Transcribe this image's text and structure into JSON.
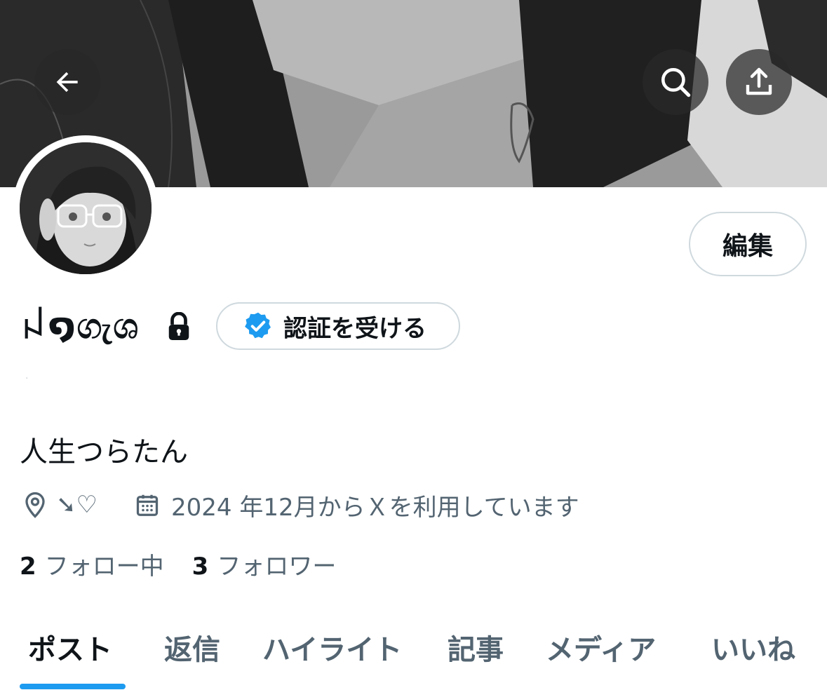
{
  "header": {
    "back_icon": "arrow-left-icon",
    "search_icon": "search-icon",
    "share_icon": "share-upload-icon"
  },
  "profile": {
    "display_name": "ꈤ໑ගැශ",
    "protected_icon": "lock-icon",
    "verify_label": "認証を受ける",
    "verify_icon": "verified-badge-icon",
    "edit_label": "編集",
    "handle": "·",
    "bio": "人生つらたん",
    "location": "➘♡",
    "location_icon": "location-pin-icon",
    "joined": "2024 年12月からＸを利用しています",
    "joined_icon": "calendar-icon",
    "following_count": "2",
    "following_label": "フォロー中",
    "followers_count": "3",
    "followers_label": "フォロワー"
  },
  "tabs": [
    {
      "label": "ポスト",
      "active": true
    },
    {
      "label": "返信"
    },
    {
      "label": "ハイライト"
    },
    {
      "label": "記事"
    },
    {
      "label": "メディア"
    },
    {
      "label": "いいね"
    }
  ],
  "colors": {
    "accent": "#1d9bf0",
    "text_primary": "#0f1419",
    "text_secondary": "#536471",
    "border": "#cfd9de"
  }
}
